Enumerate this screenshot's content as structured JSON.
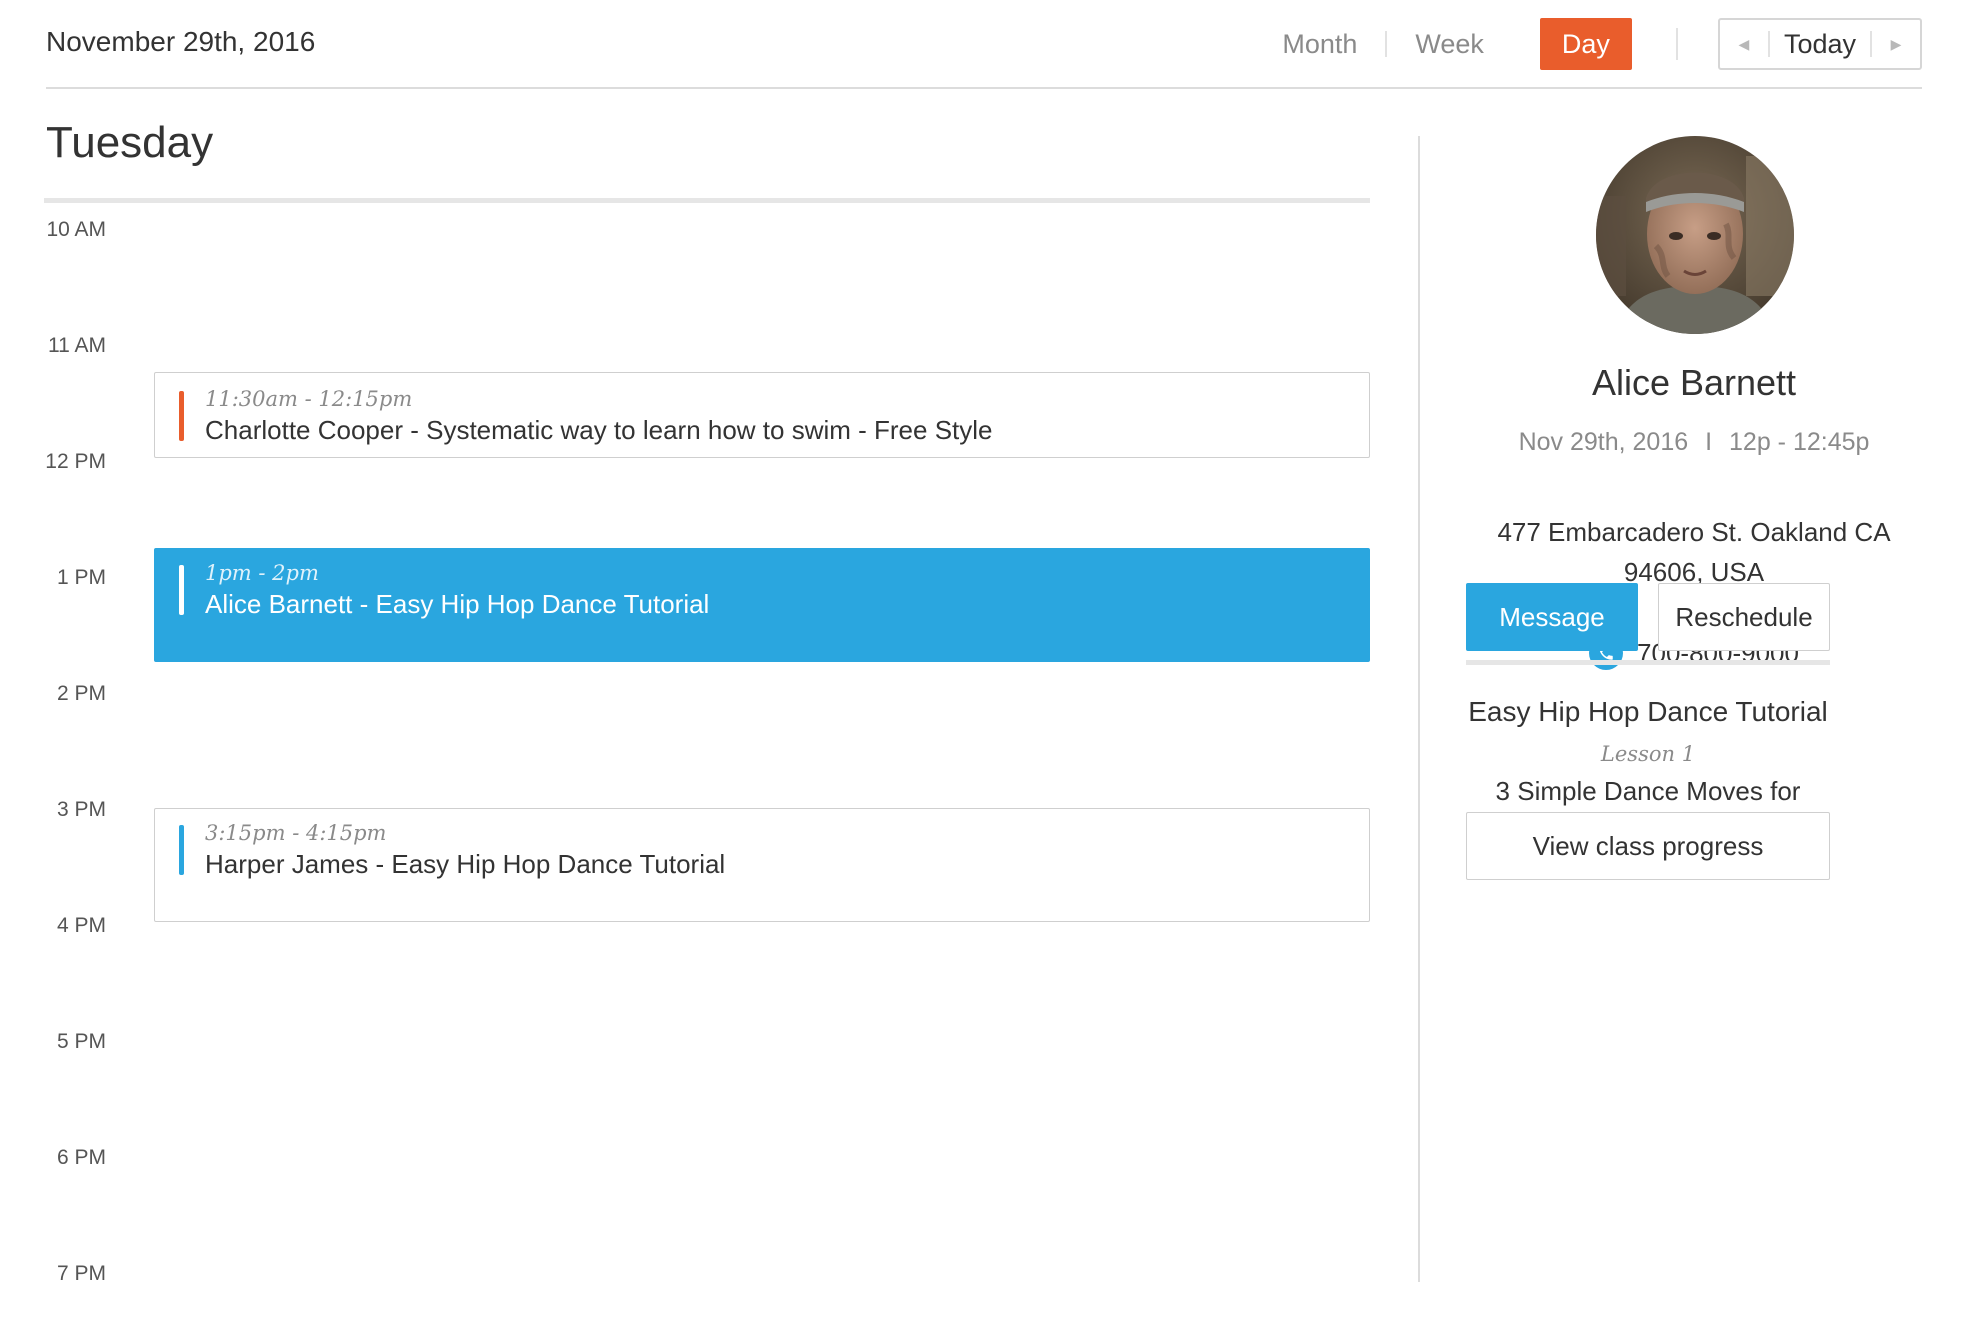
{
  "header": {
    "date": "November 29th, 2016",
    "views": {
      "month": "Month",
      "week": "Week",
      "day": "Day"
    },
    "active_view": "day",
    "today_label": "Today"
  },
  "day": {
    "title": "Tuesday",
    "hours": [
      "10 AM",
      "11 AM",
      "12 PM",
      "1 PM",
      "2 PM",
      "3 PM",
      "4 PM",
      "5 PM",
      "6 PM",
      "7 PM"
    ]
  },
  "events": [
    {
      "time": "11:30am - 12:15pm",
      "title": "Charlotte Cooper - Systematic way to learn how to swim - Free Style",
      "accent": "#e95d2c",
      "selected": false
    },
    {
      "time": "1pm - 2pm",
      "title": "Alice Barnett - Easy Hip Hop Dance Tutorial",
      "accent": "#ffffff",
      "selected": true
    },
    {
      "time": "3:15pm - 4:15pm",
      "title": "Harper James - Easy Hip Hop Dance Tutorial",
      "accent": "#2aa6df",
      "selected": false
    }
  ],
  "detail": {
    "name": "Alice Barnett",
    "date": "Nov 29th, 2016",
    "time": "12p - 12:45p",
    "address_line1": "477 Embarcadero St. Oakland CA",
    "address_line2": "94606, USA",
    "phone": "700-800-9000",
    "message_label": "Message",
    "reschedule_label": "Reschedule",
    "class_title": "Easy Hip Hop Dance Tutorial",
    "lesson": "Lesson 1",
    "lesson_title": "3 Simple Dance Moves for Beginners",
    "progress_label": "View class progress"
  },
  "colors": {
    "accent_orange": "#e95d2c",
    "accent_blue": "#2aa6df"
  }
}
